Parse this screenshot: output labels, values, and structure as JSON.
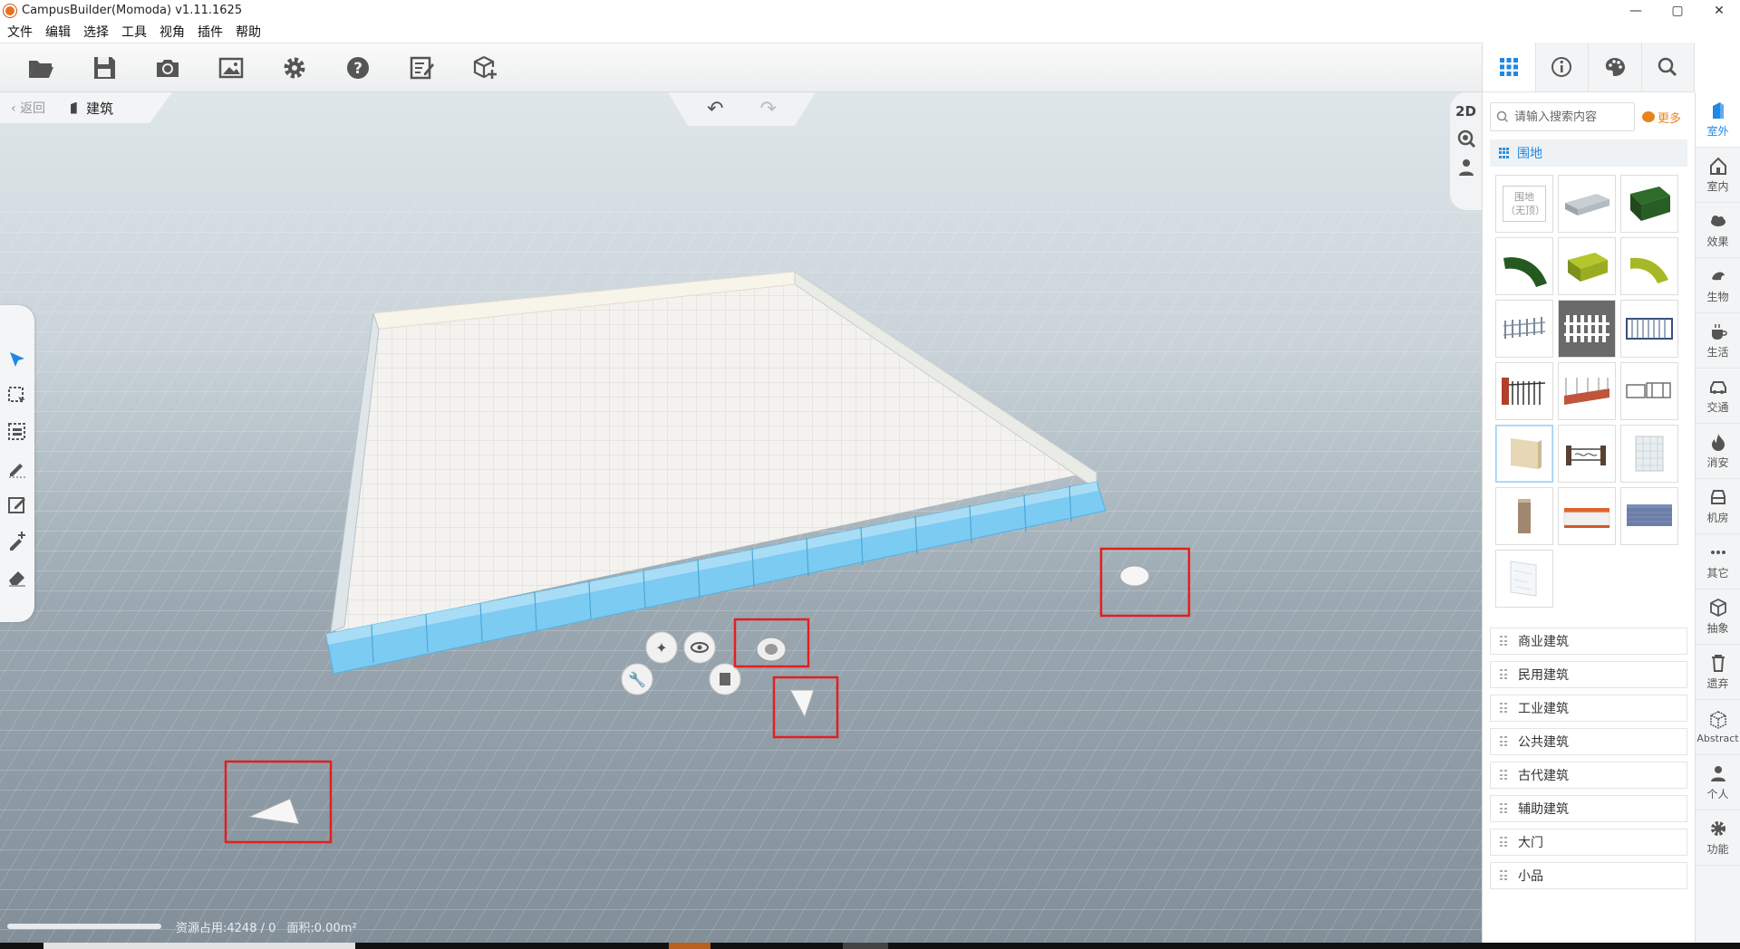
{
  "window": {
    "title": "CampusBuilder(Momoda) v1.11.1625",
    "minimize": "—",
    "maximize": "▢",
    "close": "✕"
  },
  "menu": [
    "文件",
    "编辑",
    "选择",
    "工具",
    "视角",
    "插件",
    "帮助"
  ],
  "toolbar": [
    "folder-open-icon",
    "save-icon",
    "camera-icon",
    "image-icon",
    "gear-icon",
    "help-icon",
    "edit-note-icon",
    "add-cube-icon"
  ],
  "breadcrumb": {
    "back": "返回",
    "current": "建筑"
  },
  "undo_redo": {
    "undo": "↶",
    "redo": "↷"
  },
  "view_controls": {
    "mode": "2D"
  },
  "status": {
    "resource": "资源占用:4248 / 0",
    "area": "面积:0.00m²"
  },
  "panel": {
    "search_placeholder": "请输入搜索内容",
    "more": "更多",
    "active_category": "围地",
    "first_thumb_label": "围地\n（无顶）",
    "categories": [
      "商业建筑",
      "民用建筑",
      "工业建筑",
      "公共建筑",
      "古代建筑",
      "辅助建筑",
      "大门",
      "小品"
    ]
  },
  "sidenav": [
    "室外",
    "室内",
    "效果",
    "生物",
    "生活",
    "交通",
    "消安",
    "机房",
    "其它",
    "抽象",
    "遗弃",
    "Abstract",
    "个人",
    "功能"
  ],
  "colors": {
    "accent": "#1e88e5",
    "more": "#e8841f",
    "highlight_box": "#e02020",
    "wall_selected": "#6cc4f0"
  }
}
